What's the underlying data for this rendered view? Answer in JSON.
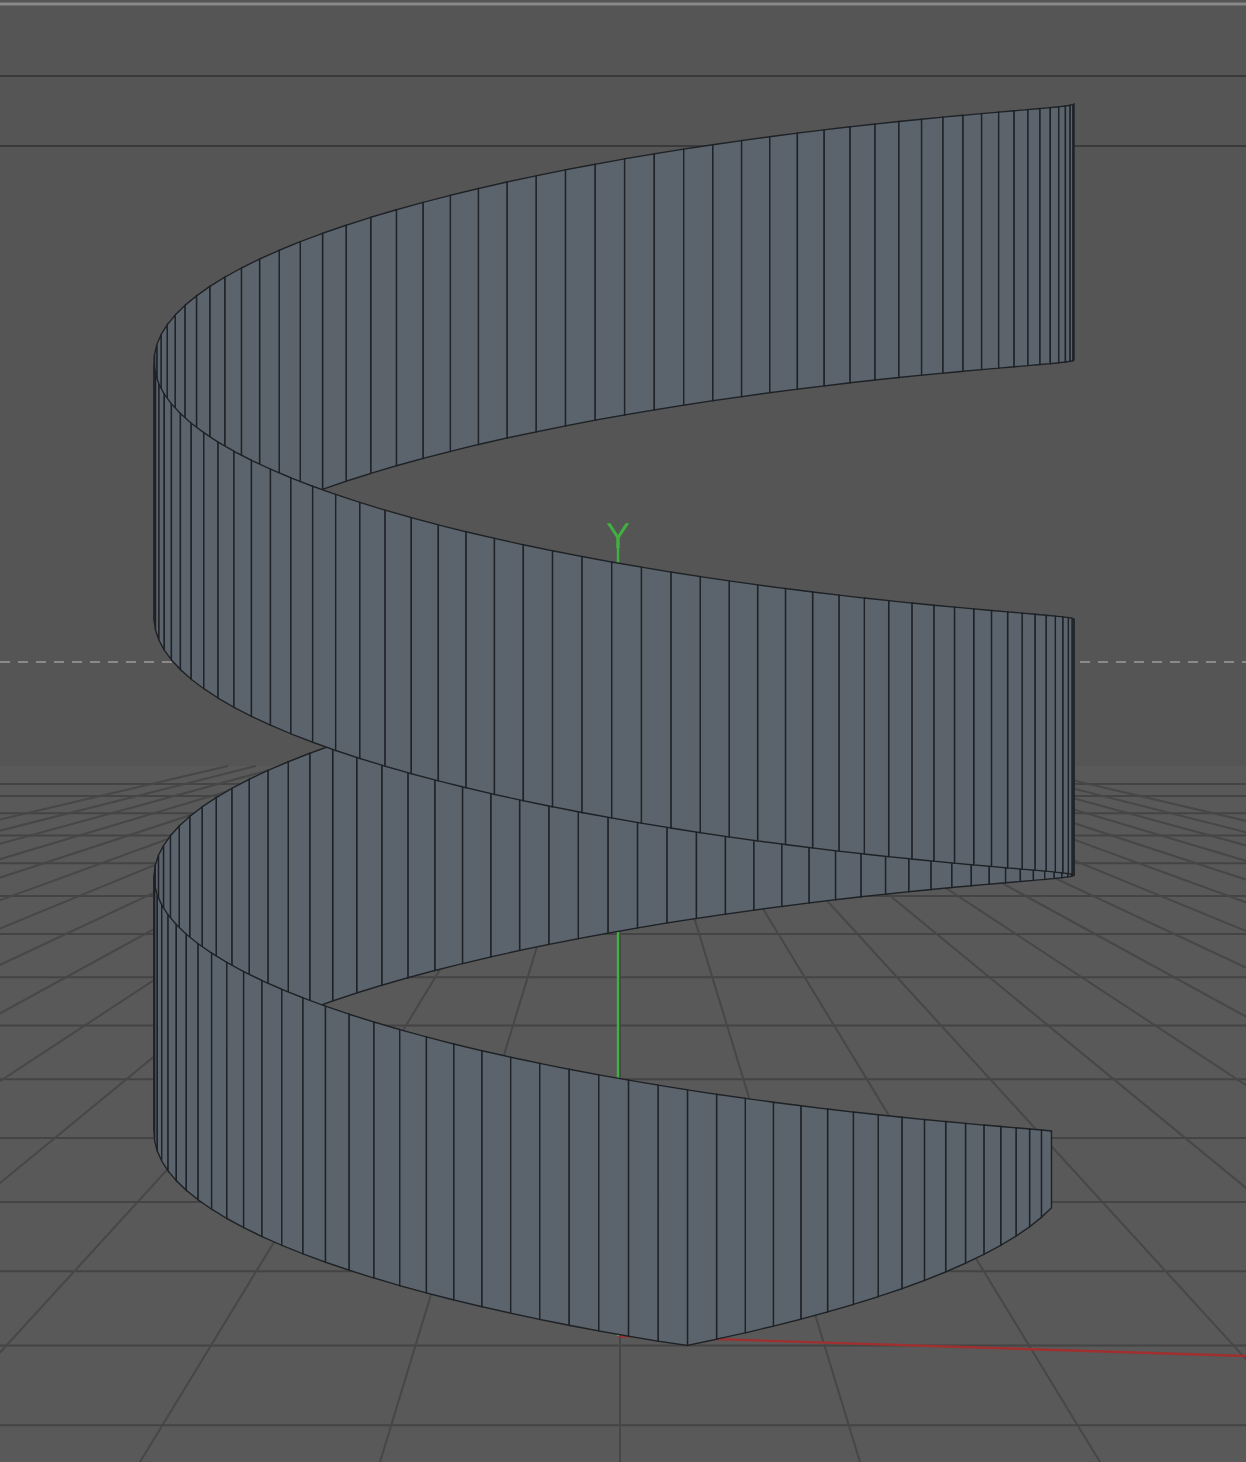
{
  "viewport": {
    "axis_label": "Y",
    "grid_visible": true,
    "axes_visible": true
  }
}
